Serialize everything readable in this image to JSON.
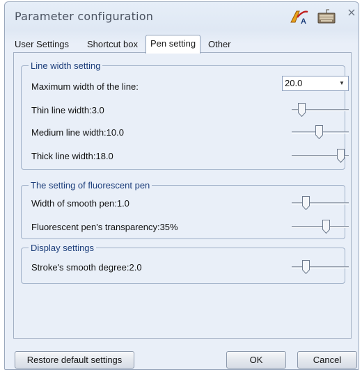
{
  "window": {
    "title": "Parameter configuration",
    "close_glyph": "×"
  },
  "icons": {
    "pen": "pen-a-icon",
    "keyboard": "keyboard-icon"
  },
  "tabs": [
    {
      "label": "User Settings"
    },
    {
      "label": "Shortcut box"
    },
    {
      "label": "Pen setting",
      "active": true
    },
    {
      "label": "Other"
    }
  ],
  "groups": {
    "line_width": {
      "legend": "Line width setting",
      "max_label": "Maximum width of the line:",
      "max_value": "20.0",
      "thin_label": "Thin line width:3.0",
      "thin_level": 0.17,
      "medium_label": "Medium line width:10.0",
      "medium_level": 0.48,
      "thick_label": "Thick line width:18.0",
      "thick_level": 0.85
    },
    "fluorescent": {
      "legend": "The setting of fluorescent pen",
      "smooth_label": "Width of smooth pen:1.0",
      "smooth_level": 0.24,
      "transparency_label": "Fluorescent pen's transparency:35%",
      "transparency_level": 0.6
    },
    "display": {
      "legend": "Display settings",
      "stroke_label": "Stroke's smooth degree:2.0",
      "stroke_level": 0.24
    }
  },
  "buttons": {
    "restore": "Restore default settings",
    "ok": "OK",
    "cancel": "Cancel"
  },
  "colors": {
    "legend_text": "#1b3d7a",
    "accent_border": "#9fb0c8"
  }
}
